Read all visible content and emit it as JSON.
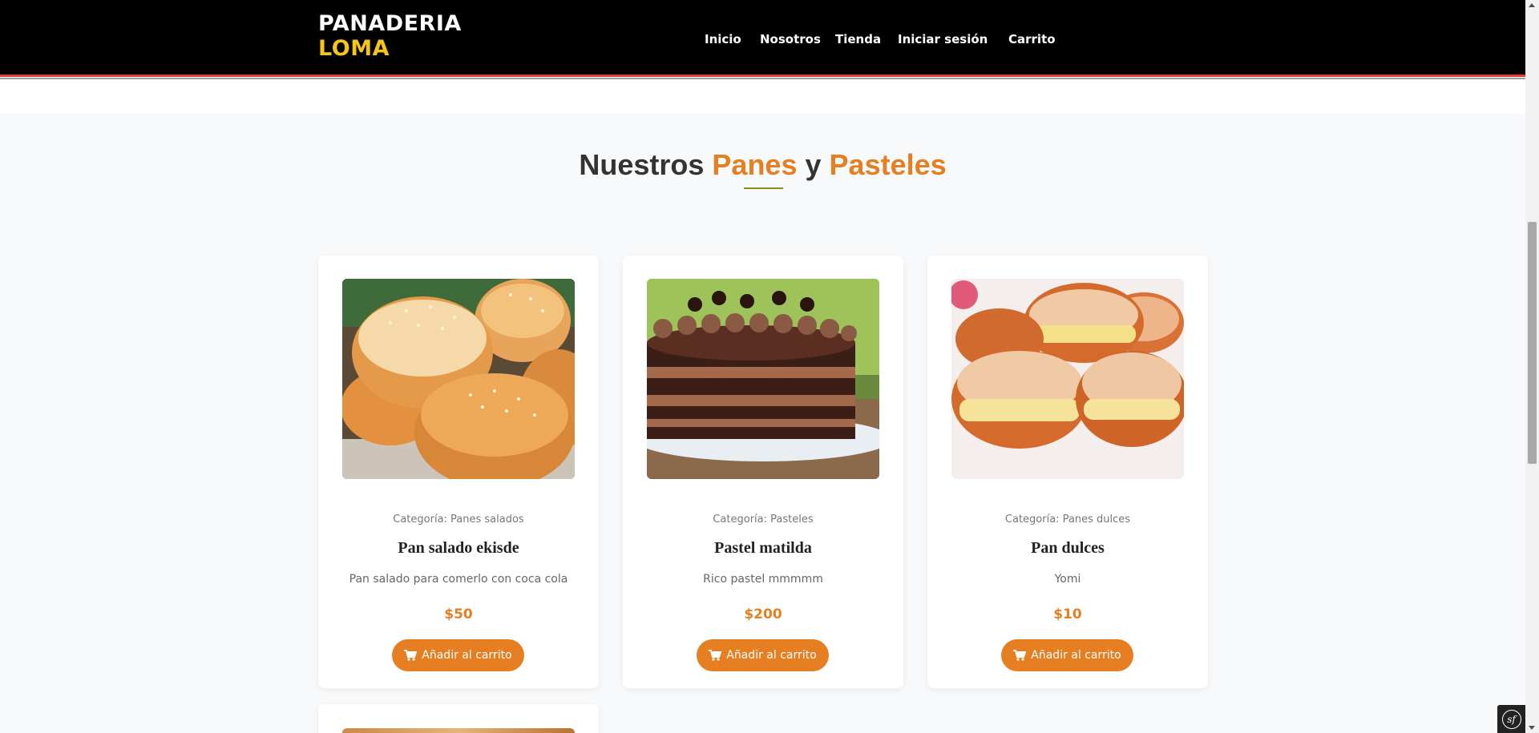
{
  "header": {
    "logo_line1": "PANADERIA",
    "logo_line2": "LOMA",
    "nav": [
      "Inicio",
      "Nosotros",
      "Tienda",
      "Iniciar sesión",
      "Carrito"
    ]
  },
  "section": {
    "title_part1": "Nuestros",
    "title_part2": "Panes",
    "title_part3": "y",
    "title_part4": "Pasteles"
  },
  "products": [
    {
      "category": "Categoría: Panes salados",
      "name": "Pan salado ekisde",
      "description": "Pan salado para comerlo con coca cola",
      "price": "$50",
      "button": "Añadir al carrito",
      "image": "sesame-buns-photo"
    },
    {
      "category": "Categoría: Pasteles",
      "name": "Pastel matilda",
      "description": "Rico pastel mmmmm",
      "price": "$200",
      "button": "Añadir al carrito",
      "image": "chocolate-cake-photo"
    },
    {
      "category": "Categoría: Panes dulces",
      "name": "Pan dulces",
      "description": "Yomi",
      "price": "$10",
      "button": "Añadir al carrito",
      "image": "cream-filled-donuts-photo"
    }
  ],
  "icons": {
    "cart": "cart-icon",
    "symfony": "symfony-icon"
  },
  "colors": {
    "accent": "#e67e22",
    "logo_yellow": "#f5c518",
    "header_bg": "#000000",
    "stripe_red": "#e53935"
  }
}
